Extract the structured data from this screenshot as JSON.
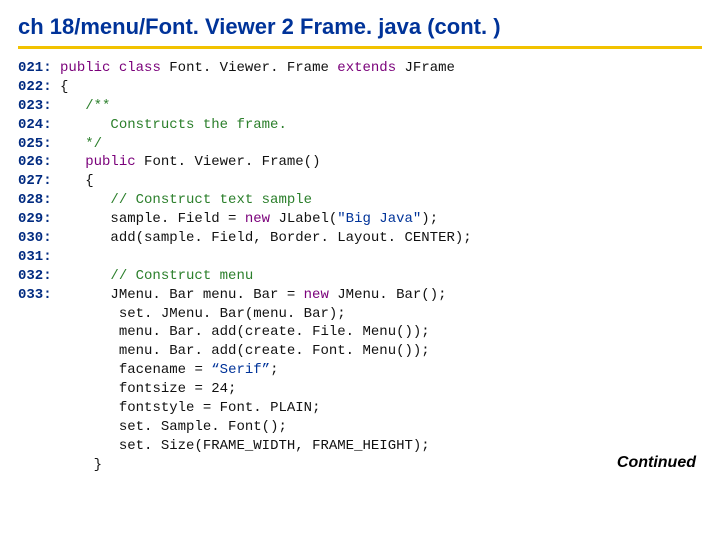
{
  "title": "ch 18/menu/Font. Viewer 2 Frame. java  (cont. )",
  "continued": "Continued",
  "ln": {
    "l021": "021:",
    "l022": "022:",
    "l023": "023:",
    "l024": "024:",
    "l025": "025:",
    "l026": "026:",
    "l027": "027:",
    "l028": "028:",
    "l029": "029:",
    "l030": "030:",
    "l031": "031:",
    "l032": "032:",
    "l033": "033:"
  },
  "kw": {
    "public1": "public",
    "class": "class",
    "extends": "extends",
    "public2": "public",
    "new1": "new",
    "new2": "new"
  },
  "txt": {
    "FontViewerFrame1": " Font. Viewer. Frame ",
    "JFrame": " JFrame",
    "lbrace1": " {",
    "spc4": "    ",
    "spc6": "      ",
    "spc7": "       ",
    "cmt_open": "/**",
    "cmt_body": "   Constructs the frame.",
    "cmt_close": "*/",
    "FontViewerFrameCtor": " Font. Viewer. Frame()",
    "lbrace2": "{",
    "cmt_textsample": "// Construct text sample",
    "sample_assign_pre": "sample. Field = ",
    "sample_assign_post": " JLabel(",
    "bigjava": "\"Big Java\"",
    "sample_assign_end": ");",
    "add_sample": "add(sample. Field, Border. Layout. CENTER);",
    "cmt_menu": "// Construct menu",
    "menubar_pre": "JMenu. Bar menu. Bar = ",
    "menubar_post": " JMenu. Bar();",
    "setJMenuBar": "set. JMenu. Bar(menu. Bar);",
    "addFileMenu": "menu. Bar. add(create. File. Menu());",
    "addFontMenu": "menu. Bar. add(create. Font. Menu());",
    "facename_pre": "facename = ",
    "serif": "“Serif”",
    "facename_post": ";",
    "fontsize": "fontsize = 24;",
    "fontstyle": "fontstyle = Font. PLAIN;",
    "setSampleFont": "set. Sample. Font();",
    "setSize": "set. Size(FRAME_WIDTH, FRAME_HEIGHT);",
    "rbrace": "   }"
  }
}
